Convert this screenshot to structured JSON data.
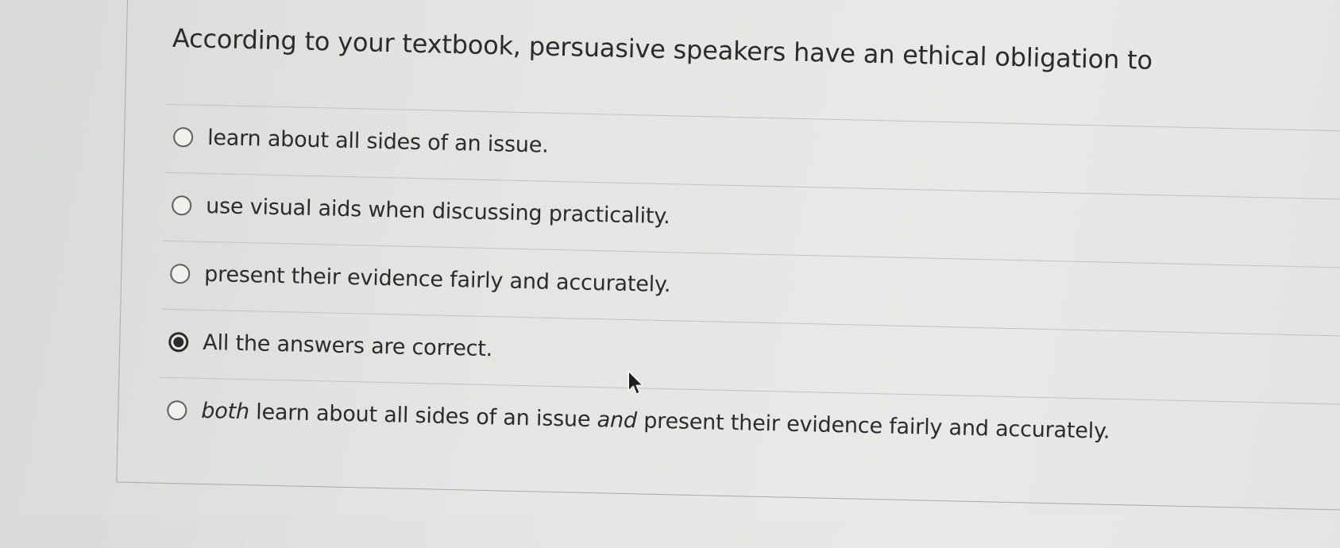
{
  "question": {
    "prompt": "According to your textbook, persuasive speakers have an ethical obligation to"
  },
  "options": [
    {
      "label": "learn about all sides of an issue.",
      "selected": false
    },
    {
      "label": "use visual aids when discussing practicality.",
      "selected": false
    },
    {
      "label": "present their evidence fairly and accurately.",
      "selected": false
    },
    {
      "label": "All the answers are correct.",
      "selected": true
    },
    {
      "label_parts": {
        "p1": "both",
        "p2": " learn about all sides of an issue ",
        "p3": "and",
        "p4": " present their evidence fairly and accurately."
      },
      "selected": false
    }
  ],
  "cursor": {
    "icon": "mouse-pointer-icon"
  }
}
